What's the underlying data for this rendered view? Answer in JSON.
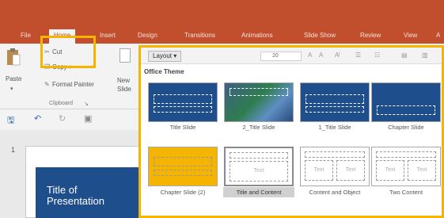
{
  "ribbon_tabs": [
    "File",
    "Home",
    "Insert",
    "Design",
    "Transitions",
    "Animations",
    "Slide Show",
    "Review",
    "View",
    "A"
  ],
  "clipboard": {
    "paste_label": "Paste",
    "paste_arrow": "▾",
    "cut_label": "Cut",
    "copy_label": "Copy",
    "copy_arrow": "▾",
    "format_painter_label": "Format Painter",
    "group_label": "Clipboard",
    "launcher": "↘"
  },
  "new_slide": {
    "label_line1": "New",
    "label_line2": "Slide"
  },
  "quick_access": {
    "save_icon": "save-icon",
    "undo_icon": "undo-icon",
    "redo_icon": "redo-icon",
    "start_icon": "start-from-beginning-icon"
  },
  "slides_pane": {
    "slide_number": "1",
    "slide_title": "Title of Presentation"
  },
  "gallery": {
    "layout_button": "Layout",
    "layout_button_arrow": "▾",
    "font_size": "20",
    "theme_heading": "Office Theme",
    "layouts": [
      {
        "name": "Title Slide"
      },
      {
        "name": "2_Title Slide"
      },
      {
        "name": "1_Title Slide"
      },
      {
        "name": "Chapter Slide"
      },
      {
        "name": "Chapter Slide (2)"
      },
      {
        "name": "Title and Content",
        "selected": true
      },
      {
        "name": "Content and Object"
      },
      {
        "name": "Two Content"
      }
    ],
    "placeholder_text": "Text"
  },
  "colors": {
    "ribbon_bar": "#c14f2e",
    "slide_blue": "#1f4e8c",
    "chapter_yellow": "#f5b400",
    "highlight": "#f5b400"
  }
}
